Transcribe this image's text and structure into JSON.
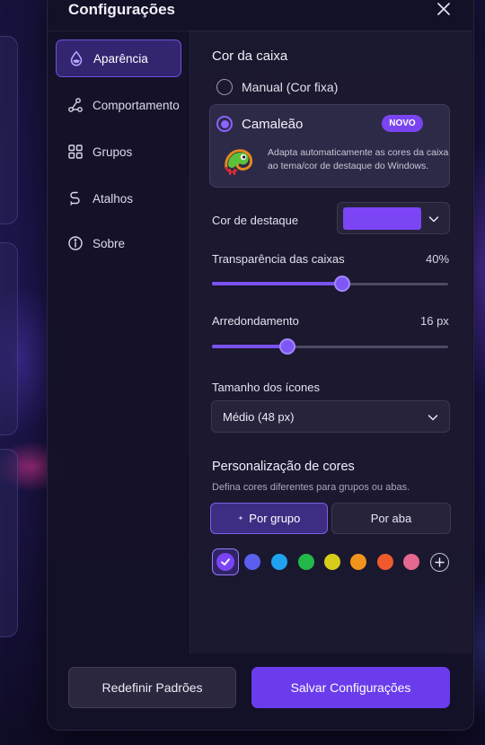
{
  "window": {
    "title": "Configurações"
  },
  "sidebar": {
    "items": [
      {
        "label": "Aparência",
        "icon": "droplet-icon",
        "active": true
      },
      {
        "label": "Comportamento",
        "icon": "nodes-icon",
        "active": false
      },
      {
        "label": "Grupos",
        "icon": "grid-icon",
        "active": false
      },
      {
        "label": "Atalhos",
        "icon": "shortcut-icon",
        "active": false
      },
      {
        "label": "Sobre",
        "icon": "info-icon",
        "active": false
      }
    ]
  },
  "appearance": {
    "box_color": {
      "title": "Cor da caixa",
      "options": [
        {
          "label": "Manual (Cor fixa)",
          "selected": false
        },
        {
          "label": "Camaleão",
          "selected": true,
          "badge": "NOVO",
          "description_line1": "Adapta automaticamente as cores da caixa",
          "description_line2": "ao tema/cor de destaque do Windows."
        }
      ]
    },
    "accent": {
      "label": "Cor de destaque",
      "color": "#7b45f5"
    },
    "transparency": {
      "label": "Transparência das caixas",
      "value_text": "40%",
      "fraction": 0.55
    },
    "rounding": {
      "label": "Arredondamento",
      "value_text": "16 px",
      "fraction": 0.32
    },
    "icon_size": {
      "label": "Tamanho dos ícones",
      "value": "Médio (48 px)"
    },
    "customization": {
      "title": "Personalização de cores",
      "subtitle": "Defina cores diferentes para grupos ou abas.",
      "tabs": [
        {
          "label": "Por grupo",
          "active": true
        },
        {
          "label": "Por aba",
          "active": false
        }
      ],
      "palette": [
        "#7b45f5",
        "#5a5ff0",
        "#1fa3f0",
        "#22b84a",
        "#d8cc1a",
        "#f2941c",
        "#ef5a2c",
        "#e4688f"
      ]
    }
  },
  "footer": {
    "reset_label": "Redefinir Padrões",
    "save_label": "Salvar Configurações"
  }
}
